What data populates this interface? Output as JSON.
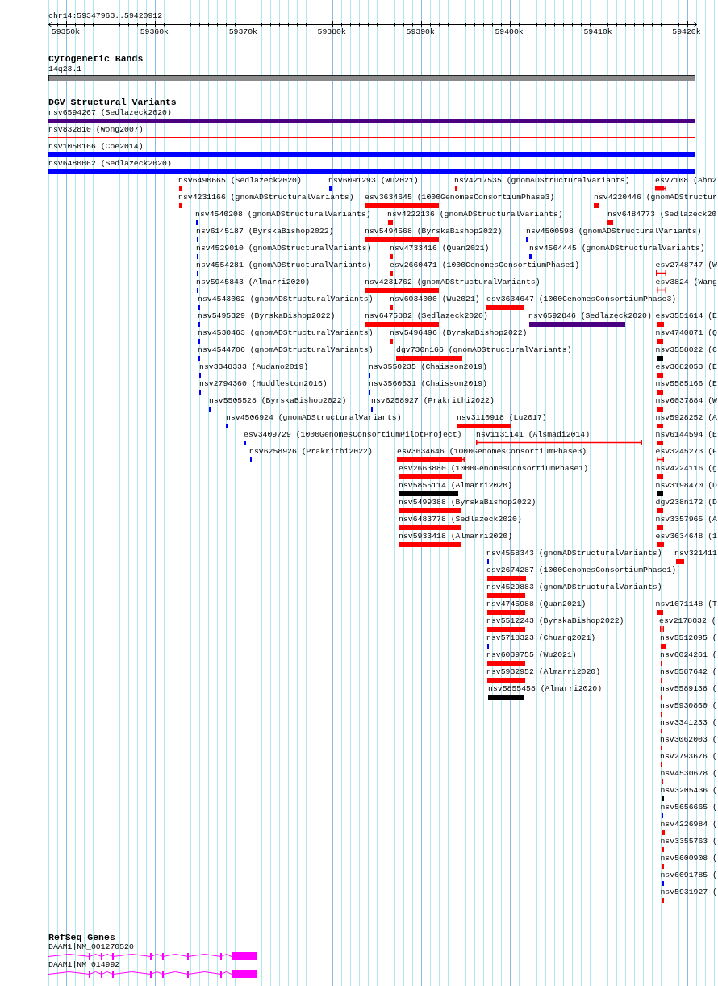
{
  "location": "chr14:59347963..59420912",
  "ruler": {
    "ticks": [
      "59350k",
      "59360k",
      "59370k",
      "59380k",
      "59390k",
      "59400k",
      "59410k",
      "59420k"
    ]
  },
  "tracks": [
    {
      "kind": "cytoband",
      "title": "Cytogenetic Bands",
      "bands": [
        {
          "name": "14q23.1"
        }
      ]
    },
    {
      "kind": "variants",
      "title": "DGV Structural Variants",
      "features": [
        {
          "label": "nsv6594267 (Sedlazeck2020)",
          "kind": "bar",
          "color": "#4b0082"
        },
        {
          "label": "nsv832810 (Wong2007)",
          "kind": "line",
          "color": "#ff0000"
        },
        {
          "label": "nsv1050166 (Coe2014)",
          "kind": "bar",
          "color": "#0000ff"
        },
        {
          "label": "nsv6480062 (Sedlazeck2020)",
          "kind": "bar",
          "color": "#0000ff"
        },
        {
          "label": "nsv6490665 (Sedlazeck2020)",
          "kind": "bar",
          "color": "#ff0000"
        },
        {
          "label": "nsv6091293 (Wu2021)",
          "kind": "bar",
          "color": "#0000ff"
        },
        {
          "label": "nsv4217535 (gnomADStructuralVariants)",
          "kind": "bar",
          "color": "#ff0000"
        },
        {
          "label": "esv7108 (Ahn2",
          "kind": "bar_bracket",
          "color": "#ff0000"
        },
        {
          "label": "nsv4231166 (gnomADStructuralVariants)",
          "kind": "bar",
          "color": "#ff0000"
        },
        {
          "label": "esv3634645 (1000GenomesConsortiumPhase3)",
          "kind": "bar",
          "color": "#ff0000"
        },
        {
          "label": "nsv4220446 (gnomADStructur",
          "kind": "bar",
          "color": "#ff0000"
        },
        {
          "label": "nsv4540208 (gnomADStructuralVariants)",
          "kind": "bar",
          "color": "#0000ff"
        },
        {
          "label": "nsv4222136 (gnomADStructuralVariants)",
          "kind": "bar",
          "color": "#ff0000"
        },
        {
          "label": "nsv6484773 (Sedlazeck20",
          "kind": "bar",
          "color": "#ff0000"
        },
        {
          "label": "nsv6145187 (ByrskaBishop2022)",
          "kind": "bar",
          "color": "#0000ff"
        },
        {
          "label": "nsv5494568 (ByrskaBishop2022)",
          "kind": "bar",
          "color": "#ff0000"
        },
        {
          "label": "nsv4500598 (gnomADStructuralVariants)",
          "kind": "bar",
          "color": "#0000ff"
        },
        {
          "label": "nsv4529010 (gnomADStructuralVariants)",
          "kind": "bar",
          "color": "#0000ff"
        },
        {
          "label": "nsv4733416 (Quan2021)",
          "kind": "bar",
          "color": "#ff0000"
        },
        {
          "label": "nsv4564445 (gnomADStructuralVariants)",
          "kind": "bar",
          "color": "#0000ff"
        },
        {
          "label": "nsv4554281 (gnomADStructuralVariants)",
          "kind": "bar",
          "color": "#0000ff"
        },
        {
          "label": "esv2660471 (1000GenomesConsortiumPhase1)",
          "kind": "bar",
          "color": "#ff0000"
        },
        {
          "label": "esv2748747 (W",
          "kind": "bracket",
          "color": "#ff0000"
        },
        {
          "label": "nsv5945843 (Almarri2020)",
          "kind": "bar",
          "color": "#0000ff"
        },
        {
          "label": "nsv4231762 (gnomADStructuralVariants)",
          "kind": "bar",
          "color": "#ff0000"
        },
        {
          "label": "esv3824 (Wang",
          "kind": "bracket",
          "color": "#ff0000"
        },
        {
          "label": "nsv4543062 (gnomADStructuralVariants)",
          "kind": "bar",
          "color": "#0000ff"
        },
        {
          "label": "nsv6034000 (Wu2021)",
          "kind": "bar",
          "color": "#ff0000"
        },
        {
          "label": "esv3634647 (1000GenomesConsortiumPhase3)",
          "kind": "bar",
          "color": "#ff0000"
        },
        {
          "label": "nsv5495329 (ByrskaBishop2022)",
          "kind": "bar",
          "color": "#0000ff"
        },
        {
          "label": "nsv6475802 (Sedlazeck2020)",
          "kind": "bar",
          "color": "#ff0000"
        },
        {
          "label": "nsv6592846 (Sedlazeck2020)",
          "kind": "bar",
          "color": "#4b0082"
        },
        {
          "label": "esv3551614 (E",
          "kind": "bar",
          "color": "#ff0000"
        },
        {
          "label": "nsv4530463 (gnomADStructuralVariants)",
          "kind": "bar",
          "color": "#0000ff"
        },
        {
          "label": "nsv5496496 (ByrskaBishop2022)",
          "kind": "bar",
          "color": "#ff0000"
        },
        {
          "label": "nsv4740871 (Q",
          "kind": "bar",
          "color": "#ff0000"
        },
        {
          "label": "nsv4544706 (gnomADStructuralVariants)",
          "kind": "bar",
          "color": "#0000ff"
        },
        {
          "label": "dgv730n166 (gnomADStructuralVariants)",
          "kind": "bar",
          "color": "#ff0000"
        },
        {
          "label": "nsv3558022 (C",
          "kind": "bar",
          "color": "#000000"
        },
        {
          "label": "nsv3348333 (Audano2019)",
          "kind": "bar",
          "color": "#0000ff"
        },
        {
          "label": "nsv3550235 (Chaisson2019)",
          "kind": "bar",
          "color": "#0000ff"
        },
        {
          "label": "esv3682053 (E",
          "kind": "bar",
          "color": "#ff0000"
        },
        {
          "label": "nsv2794360 (Huddleston2016)",
          "kind": "bar",
          "color": "#0000ff"
        },
        {
          "label": "nsv3560531 (Chaisson2019)",
          "kind": "bar",
          "color": "#0000ff"
        },
        {
          "label": "nsv5585166 (E",
          "kind": "bar",
          "color": "#ff0000"
        },
        {
          "label": "nsv5505528 (ByrskaBishop2022)",
          "kind": "bar",
          "color": "#0000ff"
        },
        {
          "label": "nsv6258927 (Prakrithi2022)",
          "kind": "bar",
          "color": "#0000ff"
        },
        {
          "label": "nsv6037884 (W",
          "kind": "bar",
          "color": "#ff0000"
        },
        {
          "label": "nsv4506924 (gnomADStructuralVariants)",
          "kind": "bar",
          "color": "#0000ff"
        },
        {
          "label": "nsv3110918 (Lu2017)",
          "kind": "bar",
          "color": "#ff0000"
        },
        {
          "label": "nsv5928252 (A",
          "kind": "bar",
          "color": "#ff0000"
        },
        {
          "label": "esv3409729 (1000GenomesConsortiumPilotProject)",
          "kind": "bar",
          "color": "#0000ff"
        },
        {
          "label": "nsv1131141 (Alsmadi2014)",
          "kind": "bracket",
          "color": "#ff0000"
        },
        {
          "label": "nsv6144594 (E",
          "kind": "bar",
          "color": "#ff0000"
        },
        {
          "label": "nsv6258926 (Prakrithi2022)",
          "kind": "bar",
          "color": "#0000ff"
        },
        {
          "label": "esv3634646 (1000GenomesConsortiumPhase3)",
          "kind": "bar_bracket",
          "color": "#ff0000"
        },
        {
          "label": "esv3245273 (F",
          "kind": "bracket",
          "color": "#ff0000"
        },
        {
          "label": "esv2663880 (1000GenomesConsortiumPhase1)",
          "kind": "bar",
          "color": "#ff0000"
        },
        {
          "label": "nsv4224116 (g",
          "kind": "bar",
          "color": "#ff0000"
        },
        {
          "label": "nsv5855114 (Almarri2020)",
          "kind": "bar",
          "color": "#000000"
        },
        {
          "label": "nsv3198470 (D",
          "kind": "bar",
          "color": "#000000"
        },
        {
          "label": "nsv5499388 (ByrskaBishop2022)",
          "kind": "bar",
          "color": "#ff0000"
        },
        {
          "label": "dgv238n172 (D",
          "kind": "bar",
          "color": "#ff0000"
        },
        {
          "label": "nsv6483778 (Sedlazeck2020)",
          "kind": "bar",
          "color": "#ff0000"
        },
        {
          "label": "nsv3357965 (A",
          "kind": "bar",
          "color": "#ff0000"
        },
        {
          "label": "nsv5933418 (Almarri2020)",
          "kind": "bar",
          "color": "#ff0000"
        },
        {
          "label": "esv3634648 (1",
          "kind": "bar",
          "color": "#ff0000"
        },
        {
          "label": "nsv4558343 (gnomADStructuralVariants)",
          "kind": "bar",
          "color": "#0000ff"
        },
        {
          "label": "nsv321411",
          "kind": "bar",
          "color": "#ff0000"
        },
        {
          "label": "esv2674287 (1000GenomesConsortiumPhase1)",
          "kind": "bar",
          "color": "#ff0000"
        },
        {
          "label": "nsv4529883 (gnomADStructuralVariants)",
          "kind": "bar",
          "color": "#ff0000"
        },
        {
          "label": "nsv4745988 (Quan2021)",
          "kind": "bar",
          "color": "#ff0000"
        },
        {
          "label": "nsv1071148 (T",
          "kind": "bar",
          "color": "#ff0000"
        },
        {
          "label": "nsv5512243 (ByrskaBishop2022)",
          "kind": "bar",
          "color": "#ff0000"
        },
        {
          "label": "esv2178032 (",
          "kind": "bracket",
          "color": "#ff0000"
        },
        {
          "label": "nsv5718323 (Chuang2021)",
          "kind": "bar",
          "color": "#0000ff"
        },
        {
          "label": "nsv5512095 (",
          "kind": "bar",
          "color": "#ff0000"
        },
        {
          "label": "nsv6039755 (Wu2021)",
          "kind": "bar",
          "color": "#ff0000"
        },
        {
          "label": "nsv6024261 (",
          "kind": "bar",
          "color": "#ff0000"
        },
        {
          "label": "nsv5932952 (Almarri2020)",
          "kind": "bar",
          "color": "#ff0000"
        },
        {
          "label": "nsv5587642 (",
          "kind": "bar",
          "color": "#ff0000"
        },
        {
          "label": "nsv5855458 (Almarri2020)",
          "kind": "bar",
          "color": "#000000"
        },
        {
          "label": "nsv5589138 (",
          "kind": "bar",
          "color": "#ff0000"
        },
        {
          "label": "nsv5930860 (",
          "kind": "bar",
          "color": "#ff0000"
        },
        {
          "label": "nsv3341233 (",
          "kind": "bar",
          "color": "#ff0000"
        },
        {
          "label": "nsv3062003 (",
          "kind": "bar",
          "color": "#ff0000"
        },
        {
          "label": "nsv2793676 (",
          "kind": "bar",
          "color": "#ff0000"
        },
        {
          "label": "nsv4530678 (",
          "kind": "bar",
          "color": "#ff0000"
        },
        {
          "label": "nsv3205436 (",
          "kind": "bar",
          "color": "#000000"
        },
        {
          "label": "nsv5656665 (",
          "kind": "bar",
          "color": "#0000ff"
        },
        {
          "label": "nsv4226984 (",
          "kind": "bar",
          "color": "#ff0000"
        },
        {
          "label": "nsv3355763 (",
          "kind": "bar",
          "color": "#ff0000"
        },
        {
          "label": "nsv5600908 (",
          "kind": "bar",
          "color": "#ff0000"
        },
        {
          "label": "nsv6091785 (",
          "kind": "bar",
          "color": "#0000ff"
        },
        {
          "label": "nsv5931927 (",
          "kind": "bar",
          "color": "#ff0000"
        }
      ]
    },
    {
      "kind": "genes",
      "title": "RefSeq Genes",
      "genes": [
        {
          "label": "DAAM1|NM_001270520"
        },
        {
          "label": "DAAM1|NM_014992"
        }
      ]
    }
  ]
}
